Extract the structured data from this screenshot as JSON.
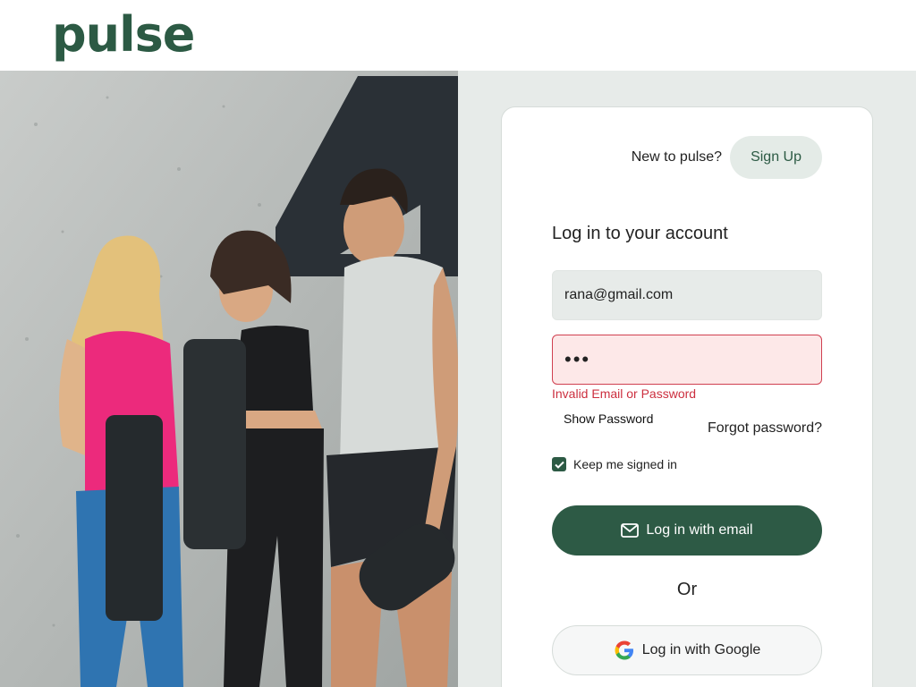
{
  "brand": {
    "name": "pulse",
    "color": "#2c5a44"
  },
  "hero": {
    "alt_icon": "fitness-photo"
  },
  "auth": {
    "signup_prompt": "New to pulse?",
    "signup_label": "Sign Up",
    "title": "Log in to your account",
    "email_value": "rana@gmail.com",
    "password_value": "•••",
    "error_text": "Invalid Email or Password",
    "show_password_label": "Show Password",
    "forgot_label": "Forgot password?",
    "keep_signed_in_label": "Keep me signed in",
    "keep_signed_in_checked": true,
    "email_login_label": "Log in with email",
    "email_login_icon": "envelope-icon",
    "or_label": "Or",
    "google_login_label": "Log in with Google",
    "google_login_icon": "google-icon"
  },
  "colors": {
    "primary": "#2d5a45",
    "error": "#cc2f3f",
    "error_bg": "#fde8e8",
    "panel_bg": "#e7ebe9"
  }
}
